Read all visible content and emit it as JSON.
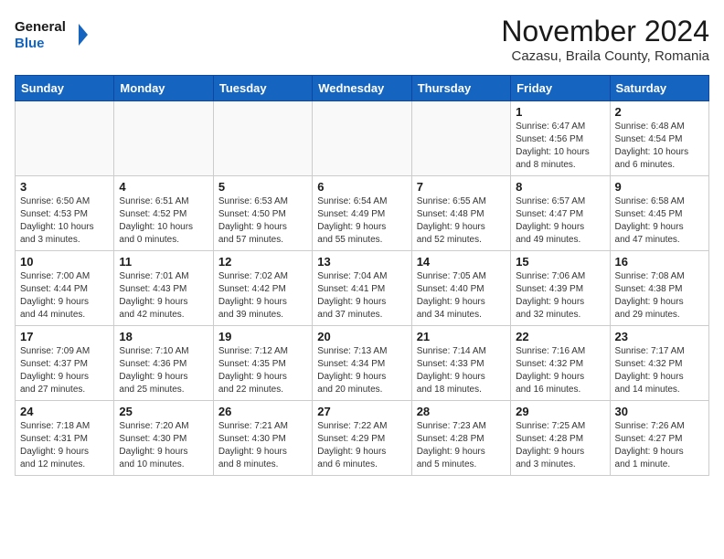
{
  "header": {
    "logo_line1": "General",
    "logo_line2": "Blue",
    "month_title": "November 2024",
    "location": "Cazasu, Braila County, Romania"
  },
  "weekdays": [
    "Sunday",
    "Monday",
    "Tuesday",
    "Wednesday",
    "Thursday",
    "Friday",
    "Saturday"
  ],
  "weeks": [
    [
      {
        "day": "",
        "info": ""
      },
      {
        "day": "",
        "info": ""
      },
      {
        "day": "",
        "info": ""
      },
      {
        "day": "",
        "info": ""
      },
      {
        "day": "",
        "info": ""
      },
      {
        "day": "1",
        "info": "Sunrise: 6:47 AM\nSunset: 4:56 PM\nDaylight: 10 hours\nand 8 minutes."
      },
      {
        "day": "2",
        "info": "Sunrise: 6:48 AM\nSunset: 4:54 PM\nDaylight: 10 hours\nand 6 minutes."
      }
    ],
    [
      {
        "day": "3",
        "info": "Sunrise: 6:50 AM\nSunset: 4:53 PM\nDaylight: 10 hours\nand 3 minutes."
      },
      {
        "day": "4",
        "info": "Sunrise: 6:51 AM\nSunset: 4:52 PM\nDaylight: 10 hours\nand 0 minutes."
      },
      {
        "day": "5",
        "info": "Sunrise: 6:53 AM\nSunset: 4:50 PM\nDaylight: 9 hours\nand 57 minutes."
      },
      {
        "day": "6",
        "info": "Sunrise: 6:54 AM\nSunset: 4:49 PM\nDaylight: 9 hours\nand 55 minutes."
      },
      {
        "day": "7",
        "info": "Sunrise: 6:55 AM\nSunset: 4:48 PM\nDaylight: 9 hours\nand 52 minutes."
      },
      {
        "day": "8",
        "info": "Sunrise: 6:57 AM\nSunset: 4:47 PM\nDaylight: 9 hours\nand 49 minutes."
      },
      {
        "day": "9",
        "info": "Sunrise: 6:58 AM\nSunset: 4:45 PM\nDaylight: 9 hours\nand 47 minutes."
      }
    ],
    [
      {
        "day": "10",
        "info": "Sunrise: 7:00 AM\nSunset: 4:44 PM\nDaylight: 9 hours\nand 44 minutes."
      },
      {
        "day": "11",
        "info": "Sunrise: 7:01 AM\nSunset: 4:43 PM\nDaylight: 9 hours\nand 42 minutes."
      },
      {
        "day": "12",
        "info": "Sunrise: 7:02 AM\nSunset: 4:42 PM\nDaylight: 9 hours\nand 39 minutes."
      },
      {
        "day": "13",
        "info": "Sunrise: 7:04 AM\nSunset: 4:41 PM\nDaylight: 9 hours\nand 37 minutes."
      },
      {
        "day": "14",
        "info": "Sunrise: 7:05 AM\nSunset: 4:40 PM\nDaylight: 9 hours\nand 34 minutes."
      },
      {
        "day": "15",
        "info": "Sunrise: 7:06 AM\nSunset: 4:39 PM\nDaylight: 9 hours\nand 32 minutes."
      },
      {
        "day": "16",
        "info": "Sunrise: 7:08 AM\nSunset: 4:38 PM\nDaylight: 9 hours\nand 29 minutes."
      }
    ],
    [
      {
        "day": "17",
        "info": "Sunrise: 7:09 AM\nSunset: 4:37 PM\nDaylight: 9 hours\nand 27 minutes."
      },
      {
        "day": "18",
        "info": "Sunrise: 7:10 AM\nSunset: 4:36 PM\nDaylight: 9 hours\nand 25 minutes."
      },
      {
        "day": "19",
        "info": "Sunrise: 7:12 AM\nSunset: 4:35 PM\nDaylight: 9 hours\nand 22 minutes."
      },
      {
        "day": "20",
        "info": "Sunrise: 7:13 AM\nSunset: 4:34 PM\nDaylight: 9 hours\nand 20 minutes."
      },
      {
        "day": "21",
        "info": "Sunrise: 7:14 AM\nSunset: 4:33 PM\nDaylight: 9 hours\nand 18 minutes."
      },
      {
        "day": "22",
        "info": "Sunrise: 7:16 AM\nSunset: 4:32 PM\nDaylight: 9 hours\nand 16 minutes."
      },
      {
        "day": "23",
        "info": "Sunrise: 7:17 AM\nSunset: 4:32 PM\nDaylight: 9 hours\nand 14 minutes."
      }
    ],
    [
      {
        "day": "24",
        "info": "Sunrise: 7:18 AM\nSunset: 4:31 PM\nDaylight: 9 hours\nand 12 minutes."
      },
      {
        "day": "25",
        "info": "Sunrise: 7:20 AM\nSunset: 4:30 PM\nDaylight: 9 hours\nand 10 minutes."
      },
      {
        "day": "26",
        "info": "Sunrise: 7:21 AM\nSunset: 4:30 PM\nDaylight: 9 hours\nand 8 minutes."
      },
      {
        "day": "27",
        "info": "Sunrise: 7:22 AM\nSunset: 4:29 PM\nDaylight: 9 hours\nand 6 minutes."
      },
      {
        "day": "28",
        "info": "Sunrise: 7:23 AM\nSunset: 4:28 PM\nDaylight: 9 hours\nand 5 minutes."
      },
      {
        "day": "29",
        "info": "Sunrise: 7:25 AM\nSunset: 4:28 PM\nDaylight: 9 hours\nand 3 minutes."
      },
      {
        "day": "30",
        "info": "Sunrise: 7:26 AM\nSunset: 4:27 PM\nDaylight: 9 hours\nand 1 minute."
      }
    ]
  ]
}
